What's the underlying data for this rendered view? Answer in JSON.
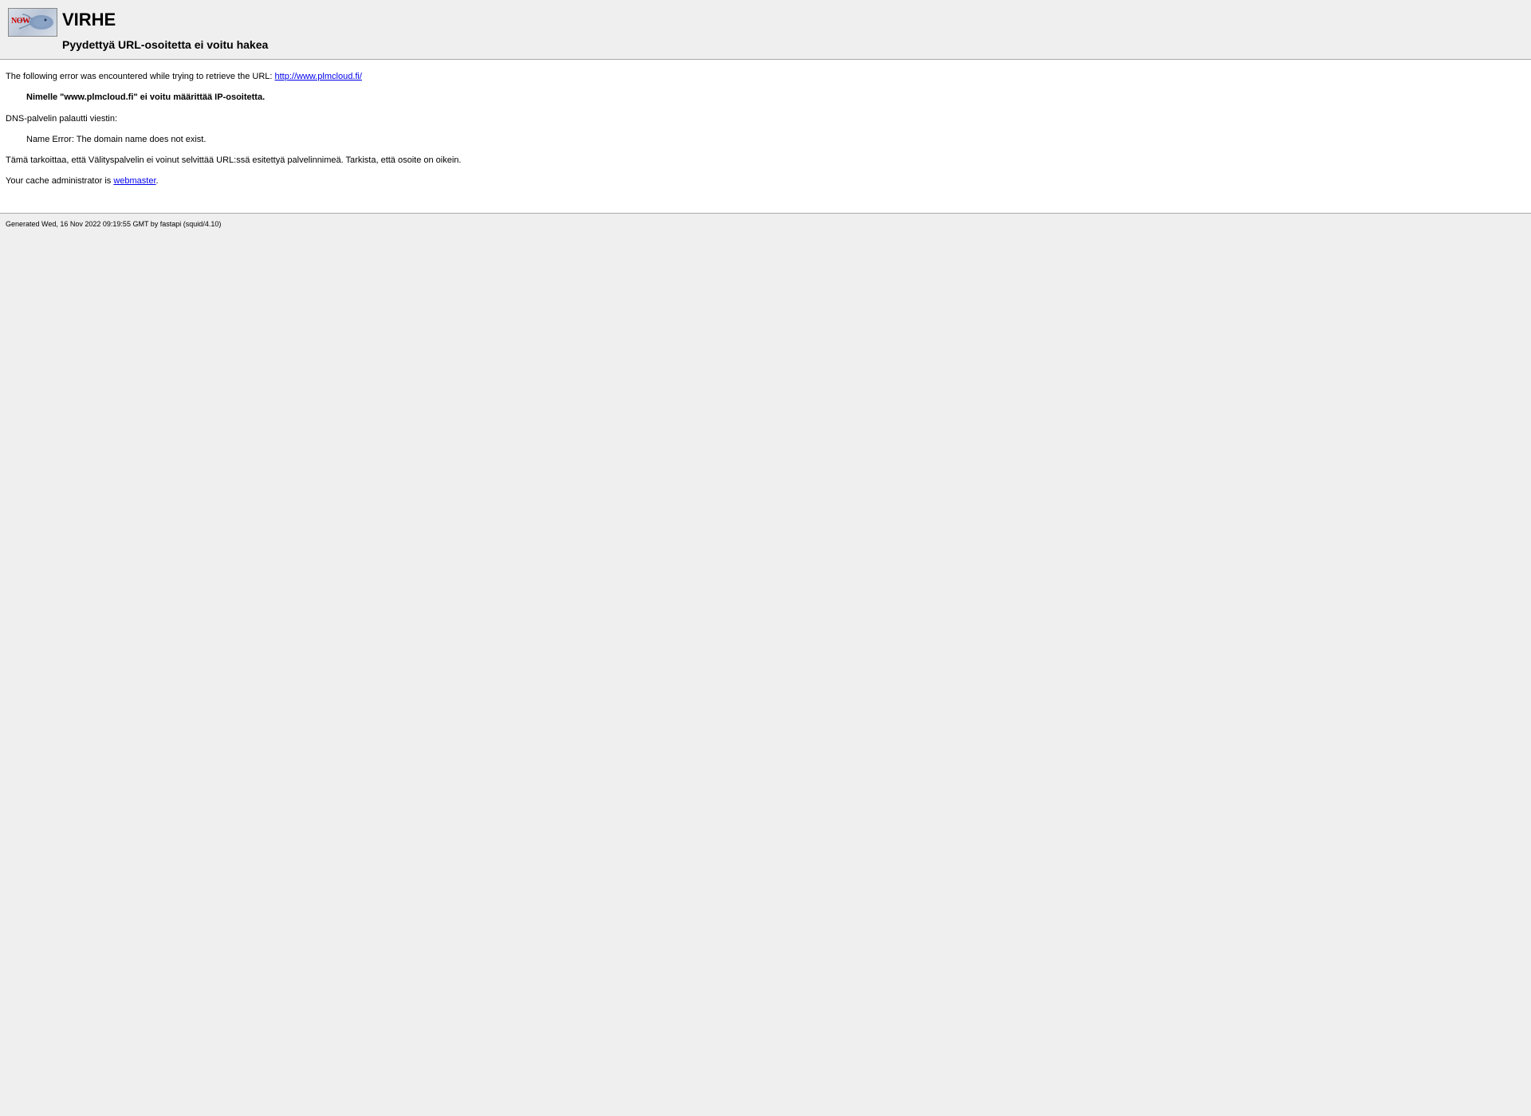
{
  "header": {
    "title": "VIRHE",
    "subtitle": "Pyydettyä URL-osoitetta ei voitu hakea",
    "logo_text": "NOW"
  },
  "content": {
    "intro_prefix": "The following error was encountered while trying to retrieve the URL: ",
    "url_link": "http://www.plmcloud.fi/",
    "error_bold": "Nimelle \"www.plmcloud.fi\" ei voitu määrittää IP-osoitetta.",
    "dns_message_label": "DNS-palvelin palautti viestin:",
    "dns_error": "Name Error: The domain name does not exist.",
    "explanation": "Tämä tarkoittaa, että Välityspalvelin ei voinut selvittää URL:ssä esitettyä palvelinnimeä. Tarkista, että osoite on oikein.",
    "admin_prefix": "Your cache administrator is ",
    "admin_link": "webmaster",
    "admin_suffix": "."
  },
  "footer": {
    "generated": "Generated Wed, 16 Nov 2022 09:19:55 GMT by fastapi (squid/4.10)"
  }
}
